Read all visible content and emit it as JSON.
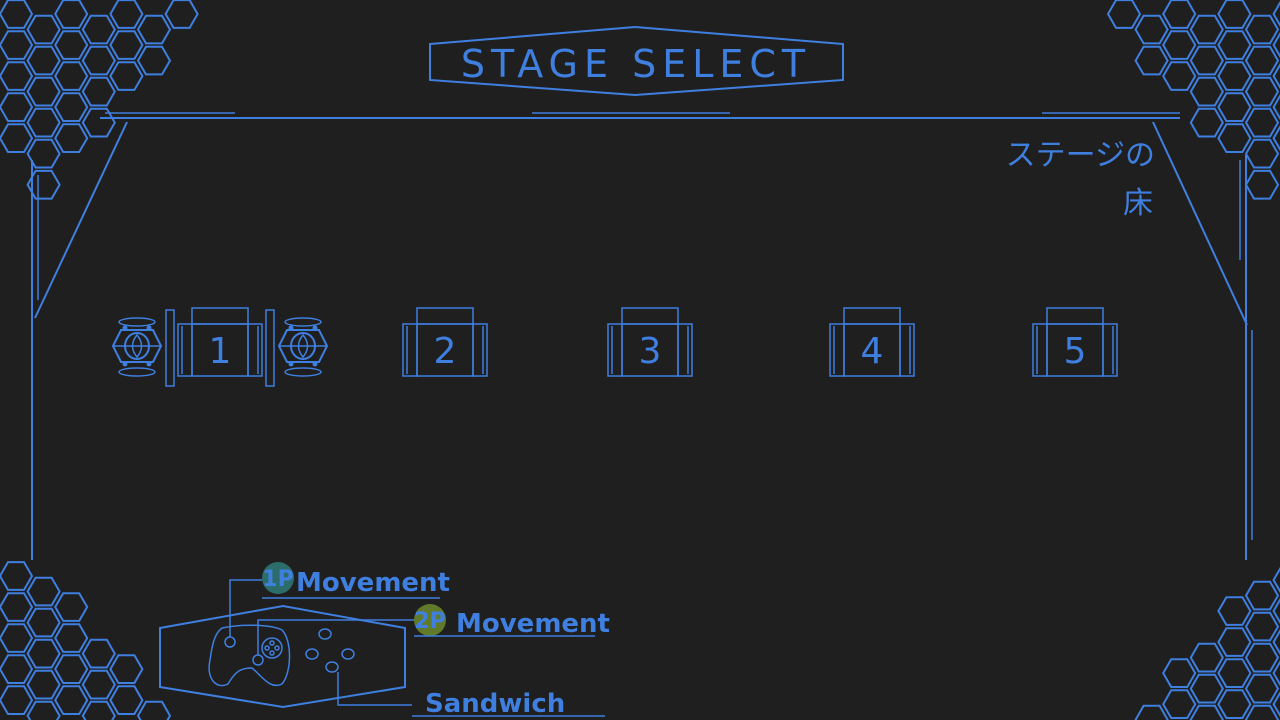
{
  "header": {
    "title": "STAGE SELECT"
  },
  "side_label": {
    "line1": "ステージの",
    "line2": "床"
  },
  "stages": [
    {
      "number": "1",
      "selected": true
    },
    {
      "number": "2",
      "selected": false
    },
    {
      "number": "3",
      "selected": false
    },
    {
      "number": "4",
      "selected": false
    },
    {
      "number": "5",
      "selected": false
    }
  ],
  "controls": {
    "p1": {
      "badge": "1P",
      "label": "Movement"
    },
    "p2": {
      "badge": "2P",
      "label": "Movement"
    },
    "action": {
      "label": "Sandwich"
    }
  },
  "colors": {
    "background": "#1f1f1f",
    "line": "#3f7fe0",
    "badge_1p": "#2f7a78",
    "badge_2p": "#6c8a2e"
  }
}
